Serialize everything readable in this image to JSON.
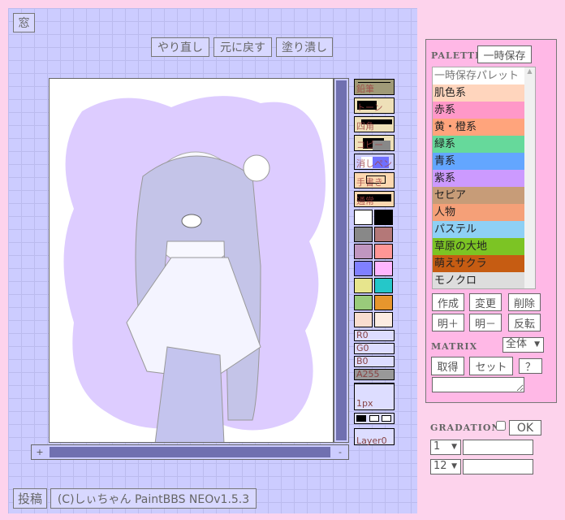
{
  "window_button": "窓",
  "toolbar": {
    "redo": "やり直し",
    "undo": "元に戻す",
    "fill": "塗り潰し"
  },
  "tools": [
    {
      "label": "鉛筆",
      "name": "pencil"
    },
    {
      "label": "トーン",
      "name": "tone"
    },
    {
      "label": "四角",
      "name": "rectangle"
    },
    {
      "label": "コピー",
      "name": "copy"
    },
    {
      "label": "消しペン",
      "name": "eraser-pen"
    },
    {
      "label": "手書き",
      "name": "freehand"
    },
    {
      "label": "通常",
      "name": "normal"
    }
  ],
  "swatches": [
    "#ffffff",
    "#000000",
    "#888888",
    "#b47878",
    "#c096c0",
    "#ff9696",
    "#8080ff",
    "#ffb6ff",
    "#e7e58d",
    "#25c7c9",
    "#99cb7b",
    "#e7962d",
    "#f9ddcf",
    "#fcece2"
  ],
  "sliders": {
    "r": "R0",
    "g": "G0",
    "b": "B0",
    "a": "A255"
  },
  "pen_size": "1px",
  "layer": "Layer0",
  "zoom_in": "+",
  "zoom_out": "-",
  "footer": {
    "post": "投稿",
    "credit": "(C)しぃちゃん PaintBBS NEOv1.5.3"
  },
  "palette": {
    "title": "PALETTE",
    "save_temp": "一時保存",
    "items": [
      {
        "label": "一時保存パレット",
        "color": "#ffffff"
      },
      {
        "label": "肌色系",
        "color": "#ffd5bd"
      },
      {
        "label": "赤系",
        "color": "#ff98c8"
      },
      {
        "label": "黄・橙系",
        "color": "#ffa47c"
      },
      {
        "label": "緑系",
        "color": "#66d99b"
      },
      {
        "label": "青系",
        "color": "#63a6ff"
      },
      {
        "label": "紫系",
        "color": "#cc9aff"
      },
      {
        "label": "セピア",
        "color": "#c79c78"
      },
      {
        "label": "人物",
        "color": "#f5a078"
      },
      {
        "label": "パステル",
        "color": "#8ed0f5"
      },
      {
        "label": "草原の大地",
        "color": "#7cc424"
      },
      {
        "label": "萌えサクラ",
        "color": "#c65c12"
      },
      {
        "label": "モノクロ",
        "color": "#dddddd"
      }
    ],
    "create": "作成",
    "change": "変更",
    "delete": "削除",
    "brighten": "明＋",
    "darken": "明－",
    "invert": "反転"
  },
  "matrix": {
    "title": "MATRIX",
    "scope": "全体",
    "get": "取得",
    "set": "セット",
    "help": "？",
    "text": ""
  },
  "gradation": {
    "title": "GRADATION",
    "enabled": false,
    "ok": "OK",
    "start": "1",
    "end": "12",
    "start_value": "",
    "end_value": ""
  }
}
